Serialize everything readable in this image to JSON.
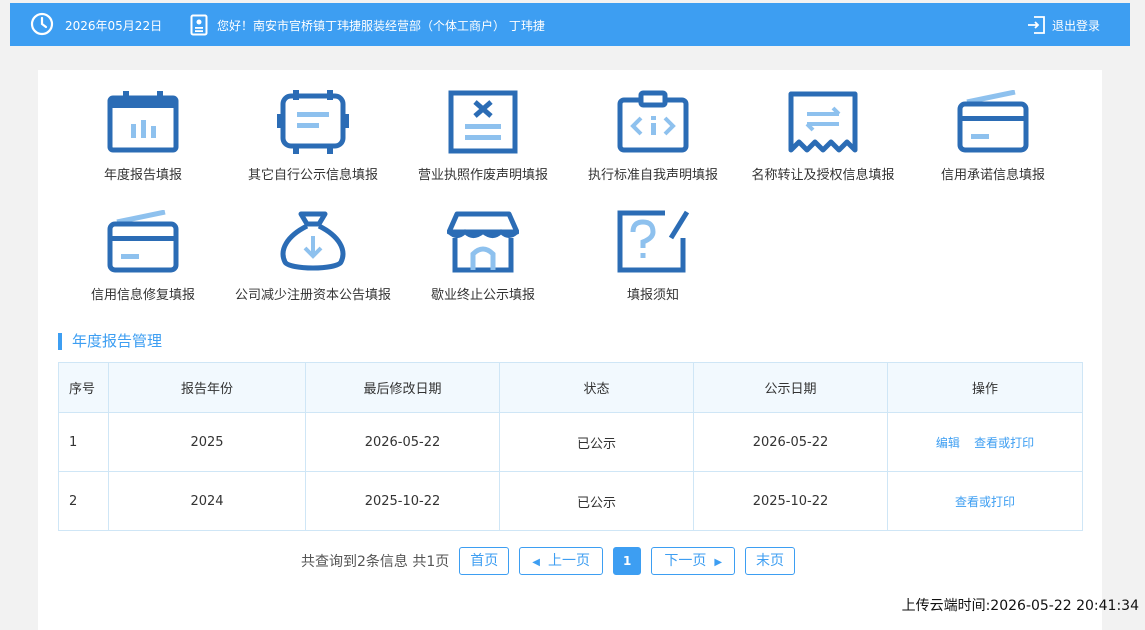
{
  "header": {
    "date": "2026年05月22日",
    "greeting": "您好！南安市官桥镇丁玮捷服装经营部（个体工商户） 丁玮捷",
    "logout_label": "退出登录"
  },
  "tiles": [
    {
      "label": "年度报告填报",
      "icon": "calendar-chart-icon"
    },
    {
      "label": "其它自行公示信息填报",
      "icon": "screen-document-icon"
    },
    {
      "label": "营业执照作废声明填报",
      "icon": "document-cancel-icon"
    },
    {
      "label": "执行标准自我声明填报",
      "icon": "clipboard-code-icon"
    },
    {
      "label": "名称转让及授权信息填报",
      "icon": "transfer-receipt-icon"
    },
    {
      "label": "信用承诺信息填报",
      "icon": "credit-card-icon"
    },
    {
      "label": "信用信息修复填报",
      "icon": "credit-card-icon"
    },
    {
      "label": "公司减少注册资本公告填报",
      "icon": "money-bag-down-icon"
    },
    {
      "label": "歇业终止公示填报",
      "icon": "store-icon"
    },
    {
      "label": "填报须知",
      "icon": "question-edit-icon"
    }
  ],
  "section_title": "年度报告管理",
  "table": {
    "headers": [
      "序号",
      "报告年份",
      "最后修改日期",
      "状态",
      "公示日期",
      "操作"
    ],
    "rows": [
      {
        "seq": "1",
        "year": "2025",
        "modified": "2026-05-22",
        "status": "已公示",
        "published": "2026-05-22",
        "actions": [
          "编辑",
          "查看或打印"
        ]
      },
      {
        "seq": "2",
        "year": "2024",
        "modified": "2025-10-22",
        "status": "已公示",
        "published": "2025-10-22",
        "actions": [
          "查看或打印"
        ]
      }
    ]
  },
  "pager": {
    "summary": "共查询到2条信息 共1页",
    "first": "首页",
    "prev": "上一页",
    "current": "1",
    "next": "下一页",
    "last": "末页"
  },
  "upload_time": "上传云端时间:2026-05-22 20:41:34",
  "colors": {
    "accent": "#3d9ef2",
    "icon_dark": "#2b6cb5",
    "icon_light": "#8ec1ee"
  }
}
